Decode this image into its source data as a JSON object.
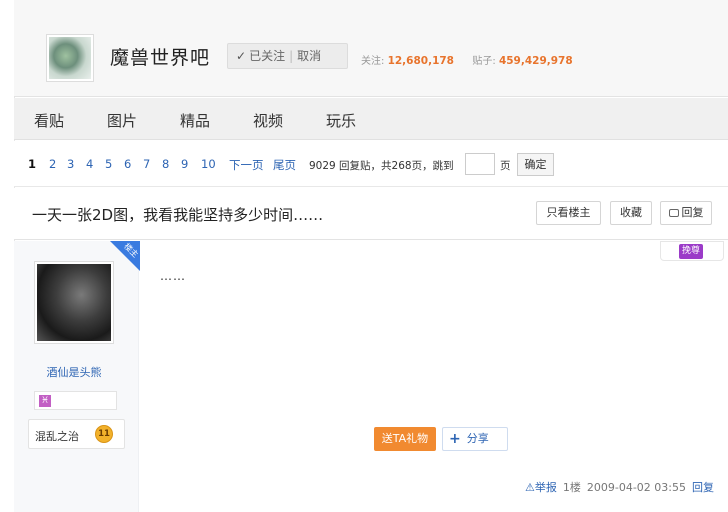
{
  "forum": {
    "name": "魔兽世界吧",
    "follow_label": "已关注",
    "unfollow_label": "取消",
    "followers_label": "关注:",
    "followers_count": "12,680,178",
    "posts_label": "贴子:",
    "posts_count": "459,429,978"
  },
  "nav": {
    "tabs": [
      "看贴",
      "图片",
      "精品",
      "视频",
      "玩乐"
    ]
  },
  "pager": {
    "current": "1",
    "pages": [
      "2",
      "3",
      "4",
      "5",
      "6",
      "7",
      "8",
      "9",
      "10"
    ],
    "next_label": "下一页",
    "last_label": "尾页",
    "info": "9029 回复贴，共268页，跳到",
    "page_unit": "页",
    "confirm_label": "确定"
  },
  "thread": {
    "title": "一天一张2D图，我看我能坚持多少时间……",
    "only_owner_label": "只看楼主",
    "favorite_label": "收藏",
    "reply_label": "回复"
  },
  "post": {
    "owner_tag": "楼主",
    "zunzhe_label": "挽尊",
    "author_name": "酒仙是头熊",
    "level_name": "混乱之治",
    "level_number": "11",
    "content": "……",
    "gift_label": "送TA礼物",
    "share_label": "分享",
    "report_label": "举报",
    "floor": "1楼",
    "timestamp": "2009-04-02 03:55",
    "reply_label": "回复"
  },
  "colors": {
    "accent_orange": "#e8742d",
    "link_blue": "#2d64b3",
    "owner_ribbon": "#3a7be0",
    "zunzhe_purple": "#9b3bc8"
  }
}
